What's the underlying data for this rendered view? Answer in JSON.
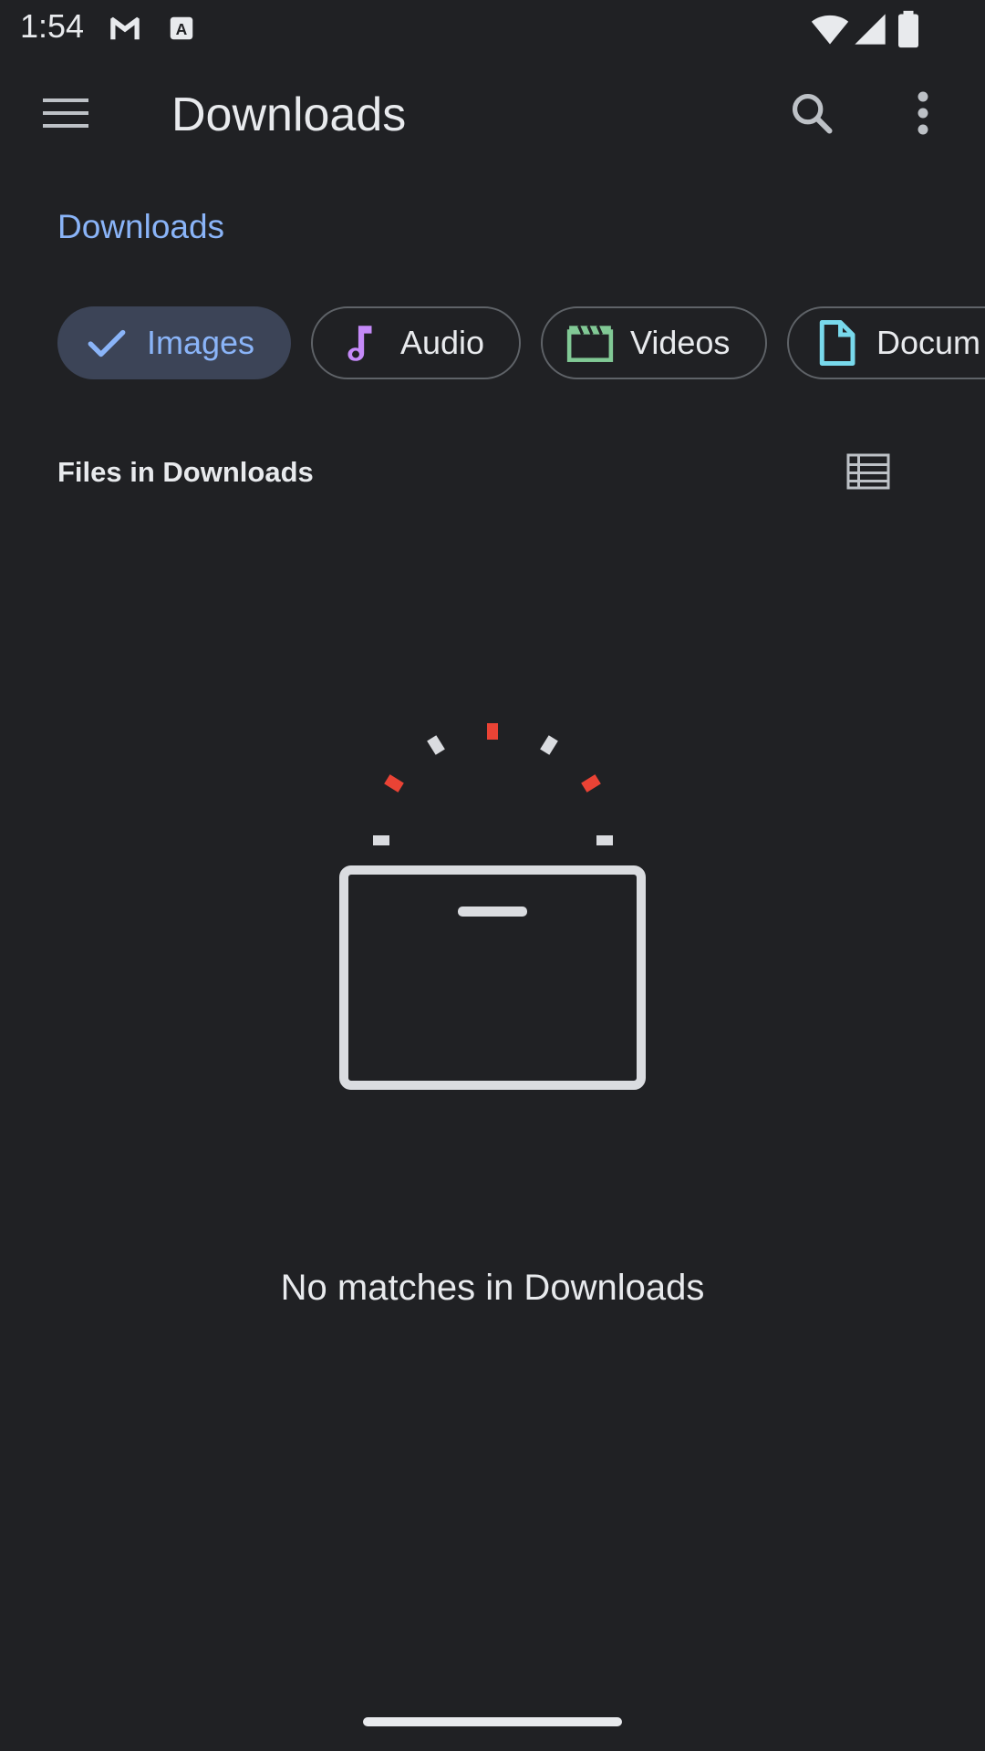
{
  "status_bar": {
    "time": "1:54",
    "left_icons": [
      "gmail-icon",
      "text-a-icon"
    ],
    "right_icons": [
      "wifi-icon",
      "cell-signal-icon",
      "battery-icon"
    ]
  },
  "toolbar": {
    "title": "Downloads",
    "menu_icon": "hamburger-menu-icon",
    "search_icon": "search-icon",
    "more_icon": "more-vert-icon"
  },
  "breadcrumb": {
    "label": "Downloads"
  },
  "filter_chips": [
    {
      "label": "Images",
      "icon": "check-icon",
      "selected": true,
      "icon_color": "#8ab4f8"
    },
    {
      "label": "Audio",
      "icon": "music-note-icon",
      "selected": false,
      "icon_color": "#c58af9"
    },
    {
      "label": "Videos",
      "icon": "clapperboard-icon",
      "selected": false,
      "icon_color": "#81c995"
    },
    {
      "label": "Docum",
      "icon": "document-icon",
      "selected": false,
      "icon_color": "#78d9ec"
    }
  ],
  "section": {
    "title": "Files in Downloads",
    "view_toggle_icon": "list-view-icon"
  },
  "empty_state": {
    "message": "No matches in Downloads",
    "illustration": "empty-box-icon"
  },
  "colors": {
    "background": "#202124",
    "accent": "#8ab4f8",
    "text_primary": "#e8eaed",
    "chip_outline": "#5f6368",
    "chip_selected_bg": "#3c4457",
    "illustration_red": "#ea4335"
  }
}
